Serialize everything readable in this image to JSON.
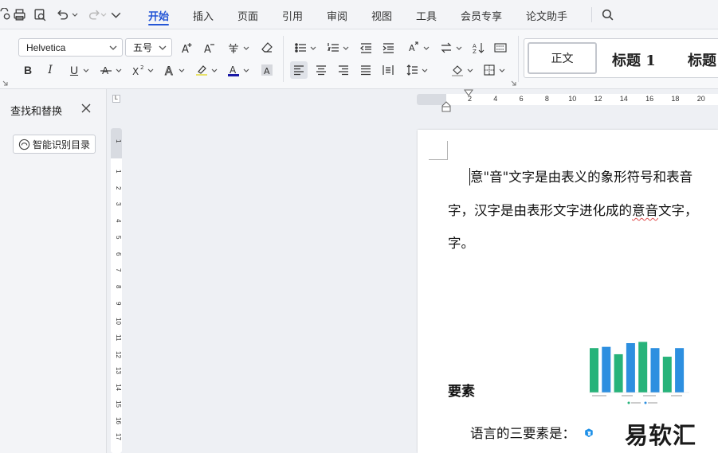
{
  "menu": {
    "tabs": [
      {
        "label": "开始",
        "active": true
      },
      {
        "label": "插入"
      },
      {
        "label": "页面"
      },
      {
        "label": "引用"
      },
      {
        "label": "审阅"
      },
      {
        "label": "视图"
      },
      {
        "label": "工具"
      },
      {
        "label": "会员专享"
      },
      {
        "label": "论文助手"
      }
    ],
    "quick_access_icons": [
      "print-icon",
      "print-preview-icon",
      "undo-icon",
      "redo-icon",
      "more-icon",
      "search-icon"
    ]
  },
  "ribbon": {
    "font_name": "Helvetica",
    "font_size": "五号",
    "font_color": "#1a1aa6",
    "highlight_color": "#e8e26a",
    "styles": {
      "normal": "正文",
      "heading1": "标题 1",
      "heading2": "标题"
    }
  },
  "left_pane": {
    "title": "查找和替换",
    "smart_button": "智能识别目录"
  },
  "rulers": {
    "horizontal": [
      "2",
      "4",
      "6",
      "8",
      "10",
      "12",
      "14",
      "16",
      "18",
      "20"
    ],
    "vertical_top": "1",
    "vertical": [
      "1",
      "2",
      "3",
      "4",
      "5",
      "6",
      "7",
      "8",
      "9",
      "10",
      "11",
      "12",
      "13",
      "14",
      "15",
      "16",
      "17"
    ],
    "corner": "L"
  },
  "document": {
    "line1": "意\"音\"文字是由表义的象形符号和表音",
    "line2_before": "字，汉字是由表形文字进化成的",
    "line2_error": "意音",
    "line2_after": "文字，",
    "line3": "字。",
    "heading": "要素",
    "line4": "语言的三要素是："
  },
  "watermark": {
    "text": "易软汇"
  },
  "colors": {
    "accent": "#2456d6",
    "chart_green": "#27b37a",
    "chart_blue": "#2d8fe0"
  }
}
